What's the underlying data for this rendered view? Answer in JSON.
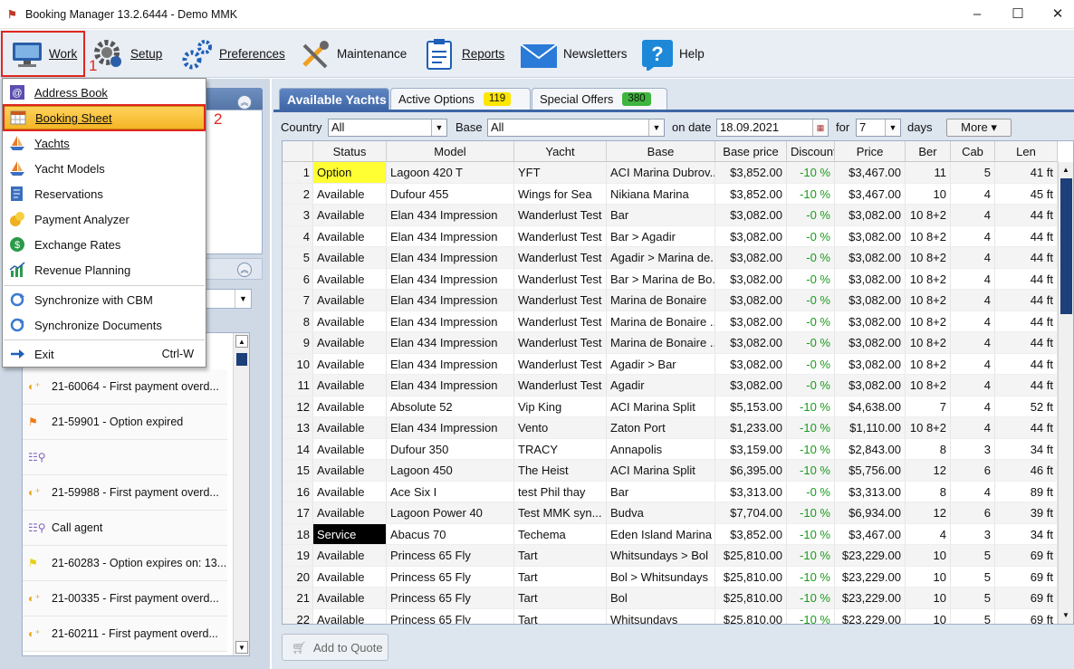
{
  "window": {
    "title": "Booking Manager 13.2.6444 - Demo MMK",
    "min": "–",
    "max": "☐",
    "close": "✕"
  },
  "toolbar": {
    "items": [
      {
        "label": "Work",
        "icon": "monitor-icon"
      },
      {
        "label": "Setup",
        "icon": "gears-icon"
      },
      {
        "label": "Preferences",
        "icon": "preferences-gears-icon"
      },
      {
        "label": "Maintenance",
        "icon": "wrench-screwdriver-icon"
      },
      {
        "label": "Reports",
        "icon": "clipboard-icon"
      },
      {
        "label": "Newsletters",
        "icon": "envelope-icon"
      },
      {
        "label": "Help",
        "icon": "question-icon"
      }
    ]
  },
  "annotations": {
    "n1": "1",
    "n2": "2"
  },
  "menu": {
    "items": [
      {
        "label": "Address Book",
        "icon": "address-book-icon"
      },
      {
        "label": "Booking Sheet",
        "icon": "calendar-grid-icon"
      },
      {
        "label": "Yachts",
        "icon": "sailboat-icon"
      },
      {
        "label": "Yacht Models",
        "icon": "sailboat-icon"
      },
      {
        "label": "Reservations",
        "icon": "reservations-icon"
      },
      {
        "label": "Payment Analyzer",
        "icon": "coins-icon"
      },
      {
        "label": "Exchange Rates",
        "icon": "currency-exchange-icon"
      },
      {
        "label": "Revenue Planning",
        "icon": "chart-icon"
      },
      {
        "label": "Synchronize with CBM",
        "icon": "sync-icon"
      },
      {
        "label": "Synchronize Documents",
        "icon": "sync-icon"
      },
      {
        "label": "Exit",
        "icon": "exit-arrow-icon",
        "shortcut": "Ctrl-W"
      }
    ]
  },
  "alerts": [
    {
      "text": "21-60064 - First payment overd...",
      "icon": "payment-icon"
    },
    {
      "text": "21-59901 - Option expired",
      "icon": "orange-flag-icon"
    },
    {
      "text": "",
      "icon": "agent-icon"
    },
    {
      "text": "21-59988 - First payment overd...",
      "icon": "payment-icon"
    },
    {
      "text": "Call agent",
      "icon": "agent-icon"
    },
    {
      "text": "21-60283 - Option expires on: 13...",
      "icon": "yellow-flag-icon"
    },
    {
      "text": "21-00335 - First payment overd...",
      "icon": "payment-icon"
    },
    {
      "text": "21-60211 - First payment overd...",
      "icon": "payment-icon"
    }
  ],
  "tabs": [
    {
      "label": "Available Yachts"
    },
    {
      "label": "Active Options",
      "badge": "119",
      "badge_color": "#ffe600"
    },
    {
      "label": "Special Offers",
      "badge": "380",
      "badge_color": "#3fb43f"
    }
  ],
  "filter": {
    "country_label": "Country",
    "country_value": "All",
    "base_label": "Base",
    "base_value": "All",
    "date_label": "on date",
    "date_value": "18.09.2021",
    "for_label": "for",
    "days_value": "7",
    "days_label": "days",
    "more": "More ▾"
  },
  "grid": {
    "columns": [
      "",
      "Status",
      "Model",
      "Yacht",
      "Base",
      "Base price",
      "Discount",
      "Price",
      "Ber",
      "Cab",
      "Len"
    ],
    "rows": [
      [
        "1",
        "Option",
        "Lagoon 420 T",
        "YFT",
        "ACI Marina Dubrov...",
        "$3,852.00",
        "-10 %",
        "$3,467.00",
        "11",
        "5",
        "41 ft"
      ],
      [
        "2",
        "Available",
        "Dufour 455",
        "Wings for Sea",
        "Nikiana Marina",
        "$3,852.00",
        "-10 %",
        "$3,467.00",
        "10",
        "4",
        "45 ft"
      ],
      [
        "3",
        "Available",
        "Elan 434 Impression",
        "Wanderlust Test",
        "Bar",
        "$3,082.00",
        "-0 %",
        "$3,082.00",
        "10 8+2",
        "4",
        "44 ft"
      ],
      [
        "4",
        "Available",
        "Elan 434 Impression",
        "Wanderlust Test",
        "Bar > Agadir",
        "$3,082.00",
        "-0 %",
        "$3,082.00",
        "10 8+2",
        "4",
        "44 ft"
      ],
      [
        "5",
        "Available",
        "Elan 434 Impression",
        "Wanderlust Test",
        "Agadir > Marina de...",
        "$3,082.00",
        "-0 %",
        "$3,082.00",
        "10 8+2",
        "4",
        "44 ft"
      ],
      [
        "6",
        "Available",
        "Elan 434 Impression",
        "Wanderlust Test",
        "Bar > Marina de Bo...",
        "$3,082.00",
        "-0 %",
        "$3,082.00",
        "10 8+2",
        "4",
        "44 ft"
      ],
      [
        "7",
        "Available",
        "Elan 434 Impression",
        "Wanderlust Test",
        "Marina de Bonaire",
        "$3,082.00",
        "-0 %",
        "$3,082.00",
        "10 8+2",
        "4",
        "44 ft"
      ],
      [
        "8",
        "Available",
        "Elan 434 Impression",
        "Wanderlust Test",
        "Marina de Bonaire ...",
        "$3,082.00",
        "-0 %",
        "$3,082.00",
        "10 8+2",
        "4",
        "44 ft"
      ],
      [
        "9",
        "Available",
        "Elan 434 Impression",
        "Wanderlust Test",
        "Marina de Bonaire ...",
        "$3,082.00",
        "-0 %",
        "$3,082.00",
        "10 8+2",
        "4",
        "44 ft"
      ],
      [
        "10",
        "Available",
        "Elan 434 Impression",
        "Wanderlust Test",
        "Agadir > Bar",
        "$3,082.00",
        "-0 %",
        "$3,082.00",
        "10 8+2",
        "4",
        "44 ft"
      ],
      [
        "11",
        "Available",
        "Elan 434 Impression",
        "Wanderlust Test",
        "Agadir",
        "$3,082.00",
        "-0 %",
        "$3,082.00",
        "10 8+2",
        "4",
        "44 ft"
      ],
      [
        "12",
        "Available",
        "Absolute 52",
        "Vip King",
        "ACI Marina Split",
        "$5,153.00",
        "-10 %",
        "$4,638.00",
        "7",
        "4",
        "52 ft"
      ],
      [
        "13",
        "Available",
        "Elan 434 Impression",
        "Vento",
        "Zaton Port",
        "$1,233.00",
        "-10 %",
        "$1,110.00",
        "10 8+2",
        "4",
        "44 ft"
      ],
      [
        "14",
        "Available",
        "Dufour 350",
        "TRACY",
        "Annapolis",
        "$3,159.00",
        "-10 %",
        "$2,843.00",
        "8",
        "3",
        "34 ft"
      ],
      [
        "15",
        "Available",
        "Lagoon 450",
        "The Heist",
        "ACI Marina Split",
        "$6,395.00",
        "-10 %",
        "$5,756.00",
        "12",
        "6",
        "46 ft"
      ],
      [
        "16",
        "Available",
        "Ace Six I",
        "test Phil thay",
        "Bar",
        "$3,313.00",
        "-0 %",
        "$3,313.00",
        "8",
        "4",
        "89 ft"
      ],
      [
        "17",
        "Available",
        "Lagoon Power 40",
        "Test MMK syn...",
        "Budva",
        "$7,704.00",
        "-10 %",
        "$6,934.00",
        "12",
        "6",
        "39 ft"
      ],
      [
        "18",
        "Service",
        "Abacus 70",
        "Techema",
        "Eden Island Marina",
        "$3,852.00",
        "-10 %",
        "$3,467.00",
        "4",
        "3",
        "34 ft"
      ],
      [
        "19",
        "Available",
        "Princess 65 Fly",
        "Tart",
        "Whitsundays > Bol",
        "$25,810.00",
        "-10 %",
        "$23,229.00",
        "10",
        "5",
        "69 ft"
      ],
      [
        "20",
        "Available",
        "Princess 65 Fly",
        "Tart",
        "Bol > Whitsundays",
        "$25,810.00",
        "-10 %",
        "$23,229.00",
        "10",
        "5",
        "69 ft"
      ],
      [
        "21",
        "Available",
        "Princess 65 Fly",
        "Tart",
        "Bol",
        "$25,810.00",
        "-10 %",
        "$23,229.00",
        "10",
        "5",
        "69 ft"
      ],
      [
        "22",
        "Available",
        "Princess 65 Fly",
        "Tart",
        "Whitsundays",
        "$25,810.00",
        "-10 %",
        "$23,229.00",
        "10",
        "5",
        "69 ft"
      ]
    ]
  },
  "add_to_quote": "Add to Quote"
}
